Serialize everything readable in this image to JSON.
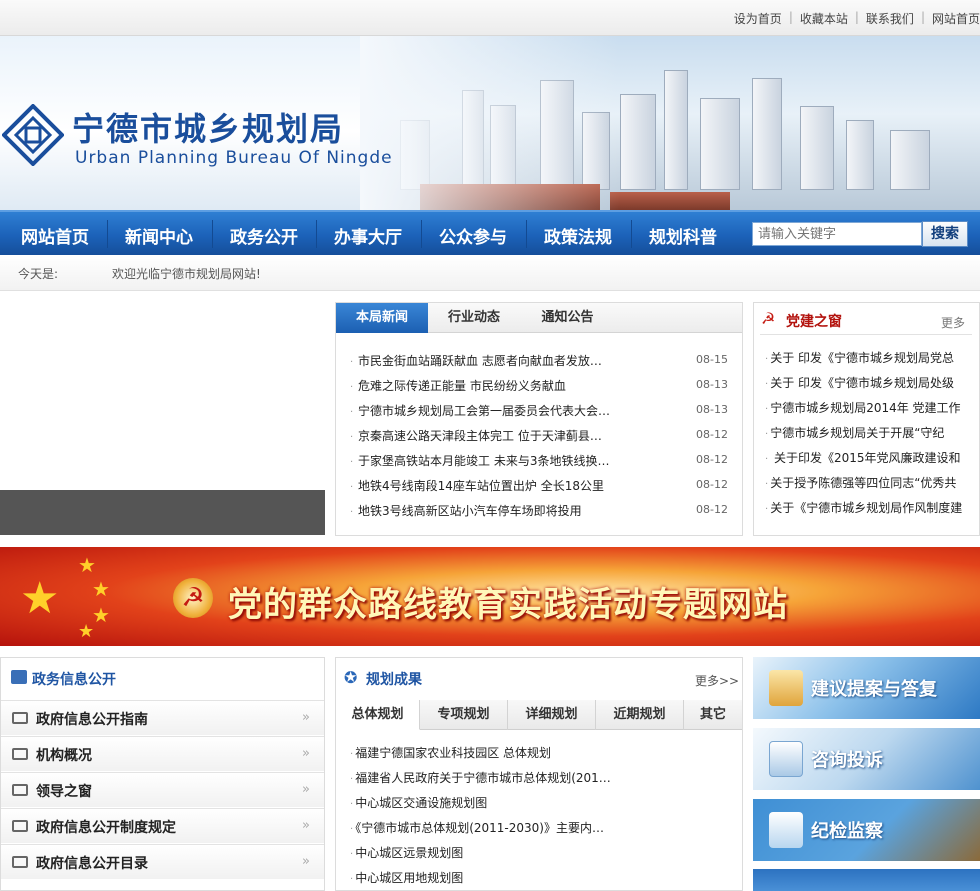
{
  "top_links": [
    "设为首页",
    "收藏本站",
    "联系我们",
    "网站首页"
  ],
  "logo": {
    "cn": "宁德市城乡规划局",
    "en": "Urban Planning Bureau Of Ningde"
  },
  "nav": [
    "网站首页",
    "新闻中心",
    "政务公开",
    "办事大厅",
    "公众参与",
    "政策法规",
    "规划科普"
  ],
  "search": {
    "placeholder": "请输入关键字",
    "button": "搜索"
  },
  "strip": {
    "today": "今天是:",
    "welcome": "欢迎光临宁德市规划局网站!"
  },
  "news": {
    "tabs": [
      "本局新闻",
      "行业动态",
      "通知公告"
    ],
    "items": [
      {
        "title": "市民金街血站踊跃献血 志愿者向献血者发放…",
        "date": "08-15"
      },
      {
        "title": "危难之际传递正能量 市民纷纷义务献血",
        "date": "08-13"
      },
      {
        "title": "宁德市城乡规划局工会第一届委员会代表大会…",
        "date": "08-13"
      },
      {
        "title": "京秦高速公路天津段主体完工 位于天津蓟县…",
        "date": "08-12"
      },
      {
        "title": "于家堡高铁站本月能竣工 未来与3条地铁线换…",
        "date": "08-12"
      },
      {
        "title": "地铁4号线南段14座车站位置出炉 全长18公里",
        "date": "08-12"
      },
      {
        "title": "地铁3号线高新区站小汽车停车场即将投用",
        "date": "08-12"
      }
    ]
  },
  "party": {
    "title": "党建之窗",
    "more": "更多",
    "items": [
      "关于 印发《宁德市城乡规划局党总",
      "关于 印发《宁德市城乡规划局处级",
      "宁德市城乡规划局2014年 党建工作",
      "宁德市城乡规划局关于开展“守纪",
      " 关于印发《2015年党风廉政建设和",
      "关于授予陈德强等四位同志“优秀共",
      "关于《宁德市城乡规划局作风制度建"
    ]
  },
  "banner": {
    "text": "党的群众路线教育实践活动专题网站"
  },
  "gov": {
    "title": "政务信息公开",
    "items": [
      "政府信息公开指南",
      "机构概况",
      "领导之窗",
      "政府信息公开制度规定",
      "政府信息公开目录"
    ]
  },
  "plan": {
    "title": "规划成果",
    "more": "更多>>",
    "tabs": [
      "总体规划",
      "专项规划",
      "详细规划",
      "近期规划",
      "其它"
    ],
    "items": [
      "福建宁德国家农业科技园区 总体规划",
      "福建省人民政府关于宁德市城市总体规划(201…",
      "中心城区交通设施规划图",
      "《宁德市城市总体规划(2011-2030)》主要内…",
      "中心城区远景规划图",
      "中心城区用地规划图"
    ]
  },
  "services": [
    "建议提案与答复",
    "咨询投诉",
    "纪检监察"
  ],
  "colors": {
    "nav_blue": "#1c62b9",
    "title_blue": "#1f55a3",
    "party_red": "#b3130e"
  }
}
